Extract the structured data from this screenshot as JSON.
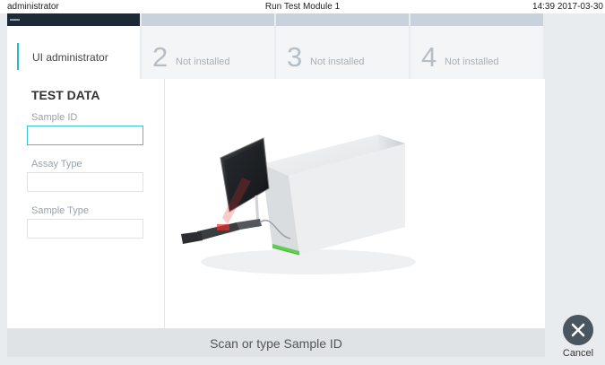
{
  "status_bar": {
    "user": "administrator",
    "title": "Run Test Module 1",
    "clock": "14:39 2017-03-30"
  },
  "tabs": [
    {
      "number": "1",
      "label": "UI administrator",
      "active": true
    },
    {
      "number": "2",
      "label": "Not installed",
      "active": false
    },
    {
      "number": "3",
      "label": "Not installed",
      "active": false
    },
    {
      "number": "4",
      "label": "Not installed",
      "active": false
    }
  ],
  "test_data": {
    "title": "TEST DATA",
    "sample_id_label": "Sample ID",
    "sample_id_value": "",
    "assay_type_label": "Assay Type",
    "assay_type_value": "",
    "sample_type_label": "Sample Type",
    "sample_type_value": ""
  },
  "bottom_bar": {
    "instruction": "Scan or type Sample ID"
  },
  "actions": {
    "cancel_label": "Cancel"
  },
  "colors": {
    "accent": "#27b9cc",
    "active_strip": "#1c2a38",
    "cancel_button": "#4a5560",
    "scanner_led": "#e0302a",
    "device_led": "#5fcf52"
  },
  "icons": {
    "cancel": "close-icon",
    "tab_handle": "tab-handle-icon"
  }
}
